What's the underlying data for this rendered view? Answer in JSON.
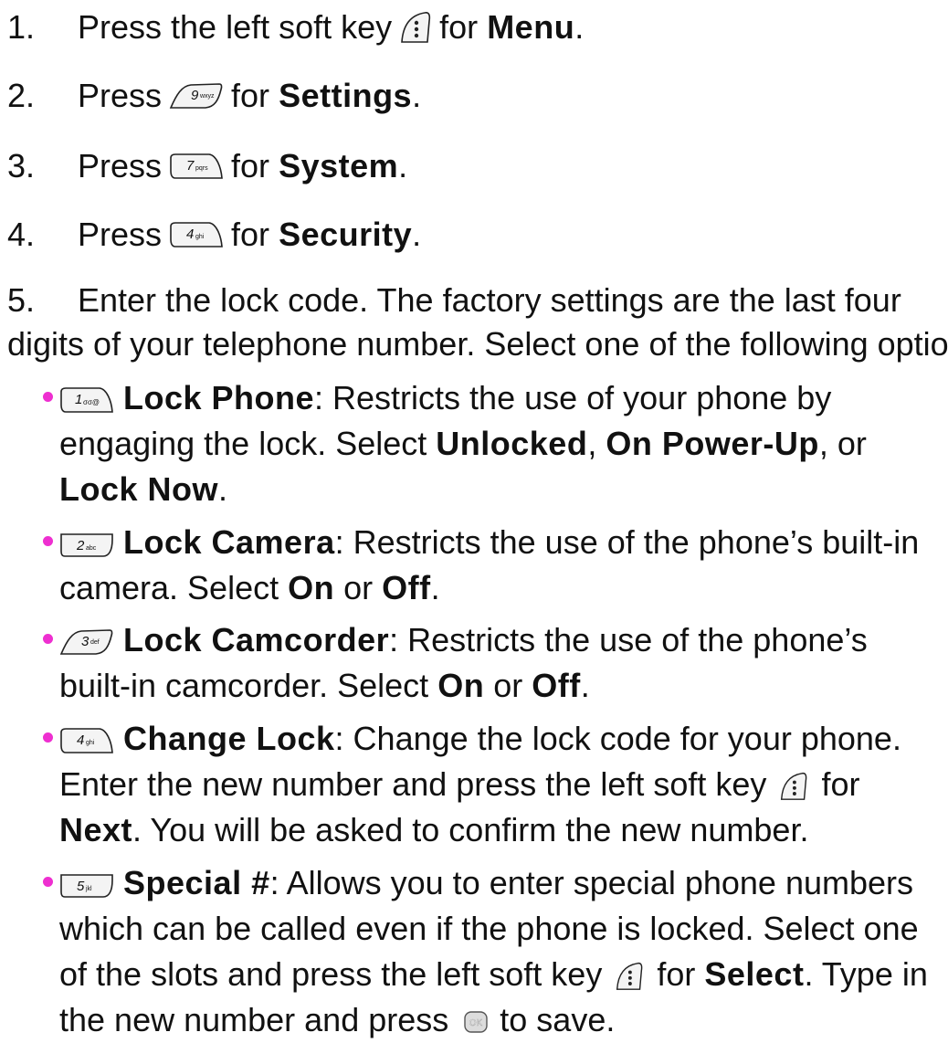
{
  "steps": [
    {
      "num": "1.",
      "pre": "Press the left soft key",
      "key_icon": "left-soft-key-icon",
      "mid": "for",
      "bold": "Menu",
      "post": "."
    },
    {
      "num": "2.",
      "pre": "Press",
      "key_icon": "key-9-wxyz-icon",
      "mid": "for",
      "bold": "Settings",
      "post": "."
    },
    {
      "num": "3.",
      "pre": "Press",
      "key_icon": "key-7-pqrs-icon",
      "mid": "for",
      "bold": "System",
      "post": "."
    },
    {
      "num": "4.",
      "pre": "Press",
      "key_icon": "key-4-ghi-icon",
      "mid": "for",
      "bold": "Security",
      "post": "."
    }
  ],
  "step5": {
    "num": "5.",
    "text_line1": "Enter the lock code. The factory settings are the last four",
    "text_line2": "digits of your telephone number. Select one of the following options:"
  },
  "options": [
    {
      "key_icon": "key-1-icon",
      "title": "Lock Phone",
      "desc_a": ": Restricts the use of your phone by engaging the lock. Select ",
      "unlocked": "Unlocked",
      "sep1": ", ",
      "powerup": "On Power-Up",
      "sep2": ", or ",
      "locknow": "Lock Now",
      "end": "."
    },
    {
      "key_icon": "key-2-abc-icon",
      "title": "Lock Camera",
      "desc_a": ": Restricts the use of the phone’s built-in camera. Select ",
      "on": "On",
      "or": " or ",
      "off": "Off",
      "end": "."
    },
    {
      "key_icon": "key-3-def-icon",
      "title": "Lock Camcorder",
      "desc_a": ": Restricts the use of the phone’s built-in camcorder. Select ",
      "on": "On",
      "or": " or ",
      "off": "Off",
      "end": "."
    },
    {
      "key_icon": "key-4-ghi-icon",
      "title": "Change Lock",
      "desc_a": ": Change the lock code for your phone. Enter the new number and press the left soft key",
      "for": " for ",
      "next": "Next",
      "desc_b": ". You will be asked to confirm the new number."
    },
    {
      "key_icon": "key-5-jkl-icon",
      "title": "Special #",
      "desc_a": ": Allows you to enter special phone numbers which can be called even if the phone is locked. Select one of the slots and press the left soft key",
      "for": " for ",
      "select": "Select",
      "desc_b": ". Type in the new number and press",
      "desc_c": " to save."
    }
  ],
  "key_labels": {
    "k1": "1",
    "k1sub": "σσ@",
    "k2": "2",
    "k2sub": "abc",
    "k3": "3",
    "k3sub": "def",
    "k4": "4",
    "k4sub": "ghi",
    "k5": "5",
    "k5sub": "jkl",
    "k7": "7",
    "k7sub": "pqrs",
    "k9": "9",
    "k9sub": "wxyz",
    "ok": "OK"
  },
  "colors": {
    "bullet": "#ee2fd0",
    "text": "#111111"
  }
}
